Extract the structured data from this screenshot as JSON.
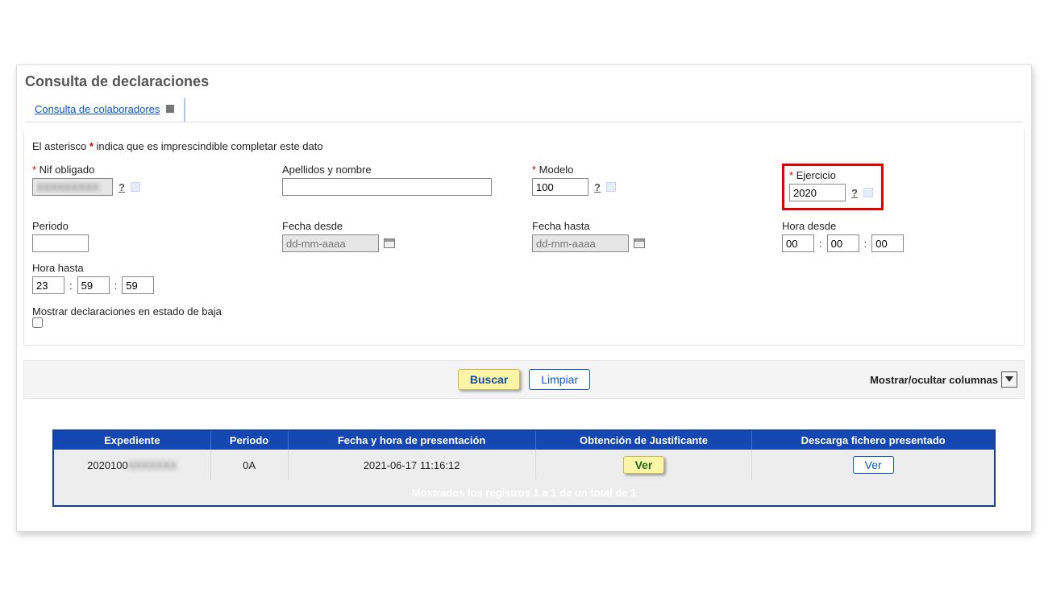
{
  "page": {
    "title": "Consulta de declaraciones",
    "tab_label": "Consulta de colaboradores",
    "hint_pre": "El asterisco ",
    "hint_mid": "*",
    "hint_post": " indica que es imprescindible completar este dato"
  },
  "fields": {
    "nif": {
      "label": "Nif obligado",
      "value": "XXXXXXXXX",
      "required": true
    },
    "apellidos": {
      "label": "Apellidos y nombre",
      "value": "",
      "required": false
    },
    "modelo": {
      "label": "Modelo",
      "value": "100",
      "required": true
    },
    "ejercicio": {
      "label": "Ejercicio",
      "value": "2020",
      "required": true
    },
    "periodo": {
      "label": "Periodo",
      "value": ""
    },
    "fecha_desde": {
      "label": "Fecha desde",
      "placeholder": "dd-mm-aaaa"
    },
    "fecha_hasta": {
      "label": "Fecha hasta",
      "placeholder": "dd-mm-aaaa"
    },
    "hora_desde": {
      "label": "Hora desde",
      "h": "00",
      "m": "00",
      "s": "00"
    },
    "hora_hasta": {
      "label": "Hora hasta",
      "h": "23",
      "m": "59",
      "s": "59"
    },
    "mostrar_baja": {
      "label": "Mostrar declaraciones en estado de baja"
    }
  },
  "actions": {
    "buscar": "Buscar",
    "limpiar": "Limpiar",
    "mostrar_columnas": "Mostrar/ocultar columnas"
  },
  "table": {
    "headers": {
      "expediente": "Expediente",
      "periodo": "Periodo",
      "fecha_presentacion": "Fecha y hora de presentación",
      "justificante": "Obtención de Justificante",
      "descarga": "Descarga fichero presentado"
    },
    "row": {
      "expediente_prefix": "2020100",
      "expediente_blur": "XXXXXXX",
      "periodo": "0A",
      "fecha": "2021-06-17 11:16:12",
      "ver1": "Ver",
      "ver2": "Ver"
    },
    "footer": "Mostrados los registros 1 a 1 de un total de 1"
  }
}
